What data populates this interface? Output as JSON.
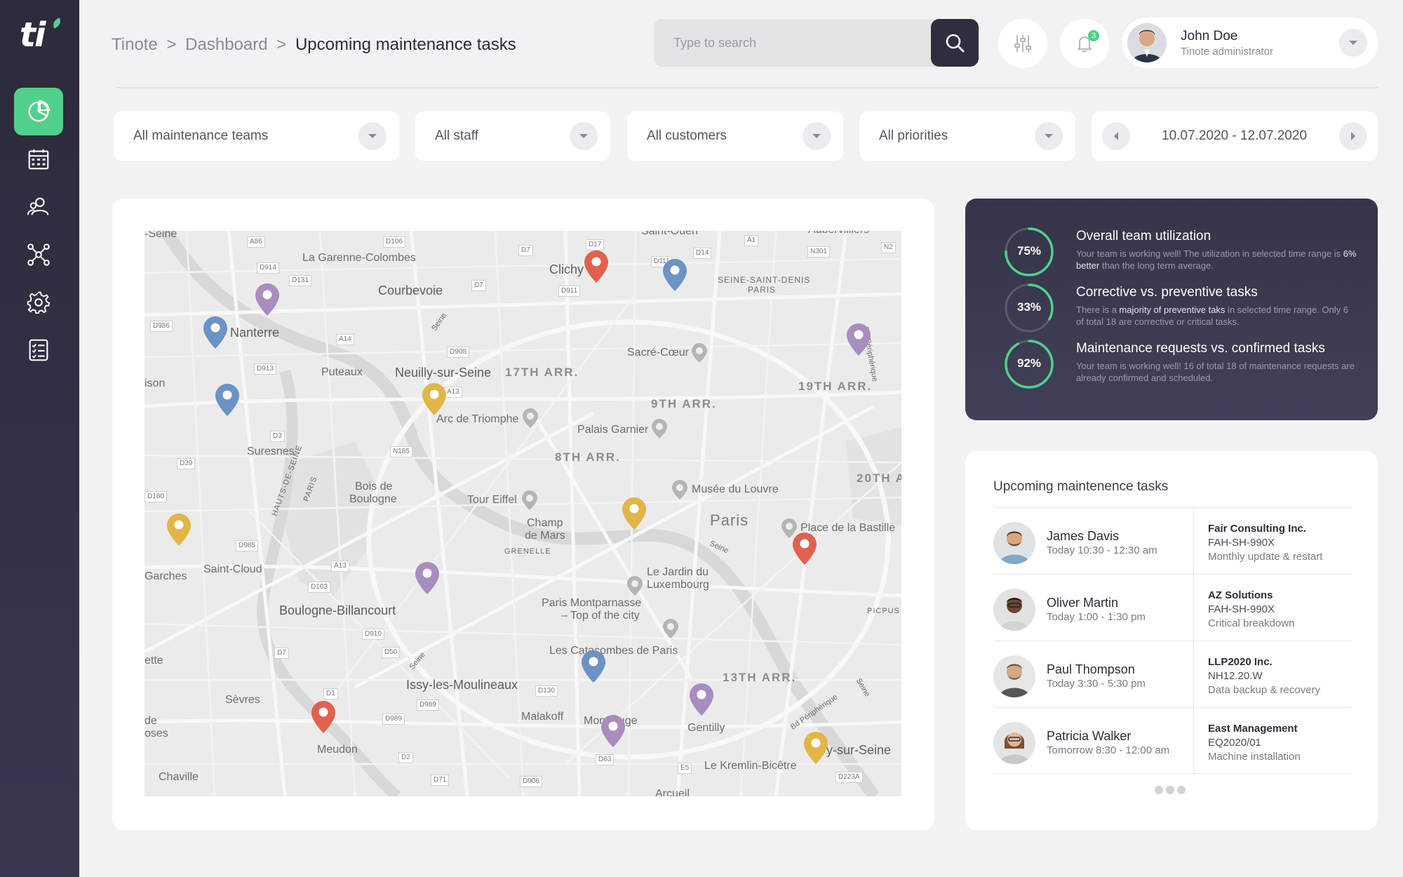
{
  "app": {
    "logo_text": "ti"
  },
  "sidebar": {
    "items": [
      {
        "name": "dashboard",
        "active": true
      },
      {
        "name": "calendar",
        "active": false
      },
      {
        "name": "team",
        "active": false
      },
      {
        "name": "network",
        "active": false
      },
      {
        "name": "settings",
        "active": false
      },
      {
        "name": "checklist",
        "active": false
      }
    ]
  },
  "header": {
    "breadcrumb": [
      "Tinote",
      "Dashboard",
      "Upcoming maintenance tasks"
    ],
    "breadcrumb_sep": ">",
    "search_placeholder": "Type to search",
    "notification_count": "3",
    "user": {
      "name": "John Doe",
      "role": "Tinote administrator"
    }
  },
  "filters": {
    "teams": "All maintenance teams",
    "staff": "All staff",
    "customers": "All customers",
    "priorities": "All priorities",
    "date_range": "10.07.2020 - 12.07.2020"
  },
  "map": {
    "labels": {
      "seine_nw": "-Seine",
      "garenne": "La Garenne-Colombes",
      "courbevoie": "Courbevoie",
      "clichy": "Clichy",
      "saint_ouen": "Saint-Ouen",
      "aubervilliers": "Aubervilliers",
      "seine_st_denis": "SEINE-SAINT-DENIS",
      "paris_small": "PARIS",
      "nanterre": "Nanterre",
      "puteaux": "Puteaux",
      "neuilly": "Neuilly-sur-Seine",
      "arr17": "17TH ARR.",
      "sacre_coeur": "Sacré-Cœur",
      "arr19": "19TH ARR.",
      "ison": "ison",
      "arc": "Arc de Triomphe",
      "arr9": "9TH ARR.",
      "garnier": "Palais Garnier",
      "suresnes": "Suresnes",
      "arr8": "8TH ARR.",
      "louvre": "Musée du Louvre",
      "arr20": "20TH A",
      "bois": "Bois de",
      "boulogne_b": "Boulogne",
      "eiffel": "Tour Eiffel",
      "paris": "Paris",
      "bastille": "Place de la Bastille",
      "champ": "Champ",
      "de_mars": "de Mars",
      "grenelle": "GRENELLE",
      "garches": "Garches",
      "saint_cloud": "Saint-Cloud",
      "jardin": "Le Jardin du",
      "luxembourg": "Luxembourg",
      "montparnasse": "Paris Montparnasse",
      "top_city": "– Top of the city",
      "boulogne_bill": "Boulogne-Billancourt",
      "picpus": "PICPUS",
      "ette": "ette",
      "catacombes": "Les Catacombes de Paris",
      "arr13": "13TH ARR.",
      "issy": "Issy-les-Moulineaux",
      "sevres": "Sèvres",
      "de": "de",
      "oses": "oses",
      "malakoff": "Malakoff",
      "montrouge": "Montrouge",
      "gentilly": "Gentilly",
      "ivry": "Ivry-sur-Seine",
      "meudon": "Meudon",
      "kremlin": "Le Kremlin-Bicêtre",
      "chaville": "Chaville",
      "arcueil": "Arcueil",
      "seine_river": "Seine",
      "bd_periph": "Bd Périphérique",
      "hauts": "HAUTS-DE-SEINE",
      "paris_v": "PARIS"
    },
    "roads": [
      "A86",
      "D106",
      "D7",
      "D17",
      "A1",
      "N301",
      "N2",
      "D914",
      "D131",
      "D7",
      "D911",
      "D111",
      "D14",
      "D986",
      "A14",
      "D908",
      "D913",
      "A13",
      "D3",
      "N185",
      "D39",
      "D180",
      "D985",
      "A13",
      "D103",
      "D910",
      "D7",
      "D50",
      "D130",
      "D989",
      "D1",
      "D989",
      "D2",
      "D63",
      "E5",
      "D71",
      "D906",
      "D223A"
    ],
    "pins": [
      {
        "color": "#a98cc0"
      },
      {
        "color": "#6b93c3"
      },
      {
        "color": "#e0624e"
      },
      {
        "color": "#6b93c3"
      },
      {
        "color": "#a98cc0"
      },
      {
        "color": "#6b93c3"
      },
      {
        "color": "#e2b646"
      },
      {
        "color": "#e2b646"
      },
      {
        "color": "#e2b646"
      },
      {
        "color": "#e0624e"
      },
      {
        "color": "#a98cc0"
      },
      {
        "color": "#6b93c3"
      },
      {
        "color": "#a98cc0"
      },
      {
        "color": "#e0624e"
      },
      {
        "color": "#a98cc0"
      },
      {
        "color": "#e2b646"
      }
    ]
  },
  "stats": {
    "accent_color": "#4fd18b",
    "items": [
      {
        "value": "75%",
        "fraction": 0.75,
        "title": "Overall team utilization",
        "desc_a": "Your team is working well! The utilization in selected time range is ",
        "desc_b": "6% better",
        "desc_c": " than the long term average."
      },
      {
        "value": "33%",
        "fraction": 0.33,
        "title": "Corrective vs. preventive tasks",
        "desc_a": "There is a ",
        "desc_b": "majority of preventive taks",
        "desc_c": " in selected time range. Only 6 of total 18 are corrective or critical tasks."
      },
      {
        "value": "92%",
        "fraction": 0.92,
        "title": "Maintenance requests vs. confirmed tasks",
        "desc_a": "Your team is working well! 16 of total 18 of maintenance requests are already confirmed and scheduled.",
        "desc_b": "",
        "desc_c": ""
      }
    ]
  },
  "tasks": {
    "title": "Upcoming maintenence tasks",
    "rows": [
      {
        "name": "James Davis",
        "time": "Today 10:30 - 12:30 am",
        "customer": "Fair Consulting Inc.",
        "code": "FAH-SH-990X",
        "desc": "Monthly update & restart"
      },
      {
        "name": "Oliver Martin",
        "time": "Today 1:00 - 1:30 pm",
        "customer": "AZ Solutions",
        "code": "FAH-SH-990X",
        "desc": "Critical breakdown"
      },
      {
        "name": "Paul Thompson",
        "time": "Today 3:30 - 5:30 pm",
        "customer": "LLP2020 Inc.",
        "code": "NH12.20.W",
        "desc": "Data backup & recovery"
      },
      {
        "name": "Patricia Walker",
        "time": "Tomorrow 8:30 - 12:00 am",
        "customer": "East Management",
        "code": "EQ2020/01",
        "desc": "Machine installation"
      }
    ]
  }
}
